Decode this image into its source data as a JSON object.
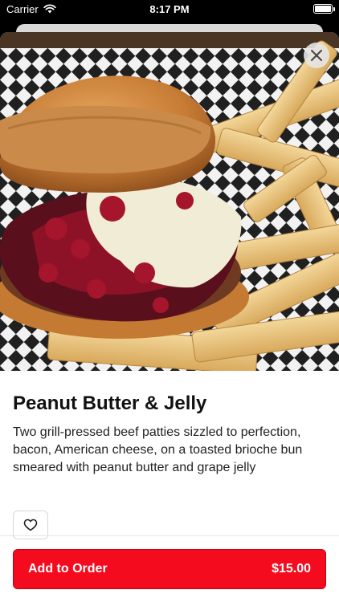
{
  "status_bar": {
    "carrier": "Carrier",
    "time": "8:17 PM",
    "wifi_icon": "wifi-icon",
    "battery_icon": "battery-icon"
  },
  "item": {
    "image_alt": "burger-with-fries-photo",
    "title": "Peanut Butter & Jelly",
    "description": "Two grill-pressed beef patties sizzled to perfection, bacon, American cheese, on a toasted brioche bun smeared with peanut butter and grape jelly",
    "close_icon": "close-icon",
    "favorite_icon": "heart-icon"
  },
  "footer": {
    "add_label": "Add to Order",
    "price": "$15.00",
    "accent_color": "#f40b1d"
  }
}
